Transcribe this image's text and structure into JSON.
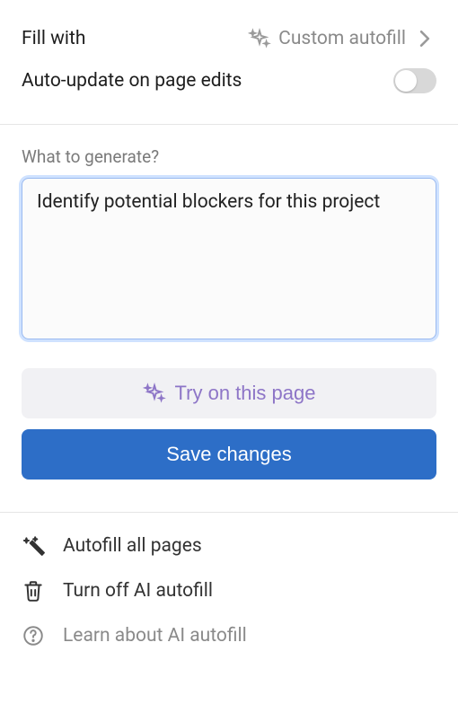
{
  "settings": {
    "fill_with_label": "Fill with",
    "fill_with_value": "Custom autofill",
    "auto_update_label": "Auto-update on page edits",
    "auto_update_enabled": false
  },
  "prompt": {
    "label": "What to generate?",
    "value": "Identify potential blockers for this project"
  },
  "buttons": {
    "try_label": "Try on this page",
    "save_label": "Save changes"
  },
  "options": {
    "autofill_all": "Autofill all pages",
    "turn_off": "Turn off AI autofill",
    "learn": "Learn about AI autofill"
  },
  "colors": {
    "primary": "#2d6ec7",
    "accent": "#8d75c7"
  }
}
